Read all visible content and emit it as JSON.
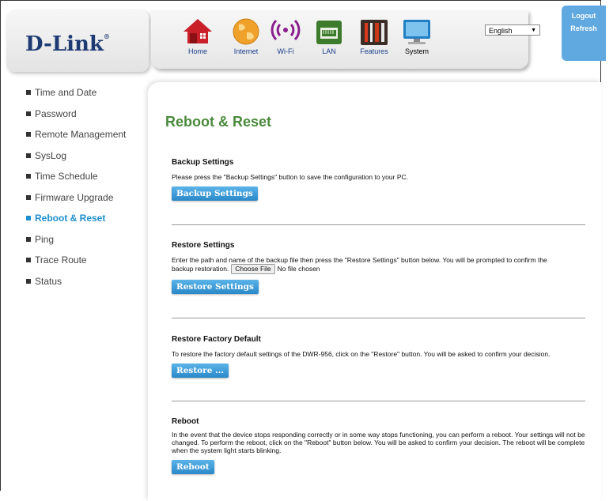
{
  "header": {
    "logo_text": "D-Link",
    "nav": [
      {
        "label": "Home",
        "icon": "house-icon"
      },
      {
        "label": "Internet",
        "icon": "globe-icon"
      },
      {
        "label": "Wi-Fi",
        "icon": "wifi-icon"
      },
      {
        "label": "LAN",
        "icon": "lan-port-icon"
      },
      {
        "label": "Features",
        "icon": "tools-icon"
      },
      {
        "label": "System",
        "icon": "monitor-icon"
      }
    ],
    "language": "English",
    "logout": "Logout",
    "refresh": "Refresh"
  },
  "sidebar": {
    "items": [
      {
        "label": "Time and Date",
        "active": false
      },
      {
        "label": "Password",
        "active": false
      },
      {
        "label": "Remote Management",
        "active": false
      },
      {
        "label": "SysLog",
        "active": false
      },
      {
        "label": "Time Schedule",
        "active": false
      },
      {
        "label": "Firmware Upgrade",
        "active": false
      },
      {
        "label": "Reboot & Reset",
        "active": true
      },
      {
        "label": "Ping",
        "active": false
      },
      {
        "label": "Trace Route",
        "active": false
      },
      {
        "label": "Status",
        "active": false
      }
    ]
  },
  "main": {
    "title": "Reboot & Reset",
    "backup": {
      "title": "Backup Settings",
      "text": "Please press the \"Backup Settings\" button to save the configuration to your PC.",
      "button": "Backup Settings"
    },
    "restore": {
      "title": "Restore Settings",
      "text": "Enter the path and name of the backup file then press the \"Restore Settings\" button below. You will be prompted to confirm the",
      "text2": "backup restoration.",
      "file_button": "Choose File",
      "file_status": "No file chosen",
      "button": "Restore Settings"
    },
    "factory": {
      "title": "Restore Factory Default",
      "text": "To restore the factory default settings of the DWR-956, click on the \"Restore\" button. You will be asked to confirm your decision.",
      "button": "Restore ..."
    },
    "reboot": {
      "title": "Reboot",
      "text": "In the event that the device stops responding correctly or in some way stops functioning, you can perform a reboot. Your settings will not be changed. To perform the reboot, click on the \"Reboot\" button below. You will be asked to confirm your decision. The reboot will be complete when the system light starts blinking.",
      "button": "Reboot"
    }
  },
  "colors": {
    "accent": "#1d8fcc",
    "title_green": "#4a8a3c",
    "button_blue": "#2a88c8",
    "auth_bg": "#5fa8e0"
  }
}
